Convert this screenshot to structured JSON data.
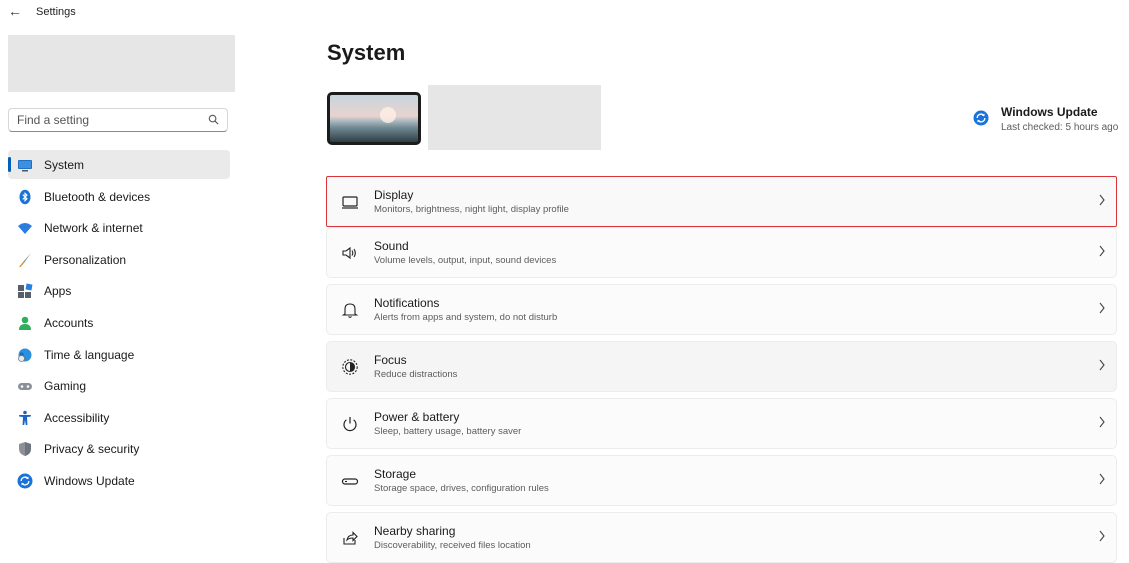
{
  "window": {
    "title": "Settings",
    "back_icon": "back-arrow-icon"
  },
  "sidebar": {
    "search_placeholder": "Find a setting",
    "items": [
      {
        "label": "System",
        "icon": "system-icon",
        "active": true
      },
      {
        "label": "Bluetooth & devices",
        "icon": "bluetooth-icon"
      },
      {
        "label": "Network & internet",
        "icon": "wifi-icon"
      },
      {
        "label": "Personalization",
        "icon": "brush-icon"
      },
      {
        "label": "Apps",
        "icon": "apps-icon"
      },
      {
        "label": "Accounts",
        "icon": "accounts-icon"
      },
      {
        "label": "Time & language",
        "icon": "globe-clock-icon"
      },
      {
        "label": "Gaming",
        "icon": "gamepad-icon"
      },
      {
        "label": "Accessibility",
        "icon": "accessibility-icon"
      },
      {
        "label": "Privacy & security",
        "icon": "shield-icon"
      },
      {
        "label": "Windows Update",
        "icon": "windows-update-icon"
      }
    ]
  },
  "main": {
    "title": "System",
    "windows_update": {
      "title": "Windows Update",
      "subtitle": "Last checked: 5 hours ago"
    },
    "cards": [
      {
        "title": "Display",
        "subtitle": "Monitors, brightness, night light, display profile",
        "icon": "display-icon"
      },
      {
        "title": "Sound",
        "subtitle": "Volume levels, output, input, sound devices",
        "icon": "speaker-icon"
      },
      {
        "title": "Notifications",
        "subtitle": "Alerts from apps and system, do not disturb",
        "icon": "bell-icon"
      },
      {
        "title": "Focus",
        "subtitle": "Reduce distractions",
        "icon": "focus-icon"
      },
      {
        "title": "Power & battery",
        "subtitle": "Sleep, battery usage, battery saver",
        "icon": "power-icon"
      },
      {
        "title": "Storage",
        "subtitle": "Storage space, drives, configuration rules",
        "icon": "storage-icon"
      },
      {
        "title": "Nearby sharing",
        "subtitle": "Discoverability, received files location",
        "icon": "share-icon"
      }
    ]
  },
  "colors": {
    "accent": "#005fb8",
    "highlight_border": "#d9343a"
  }
}
